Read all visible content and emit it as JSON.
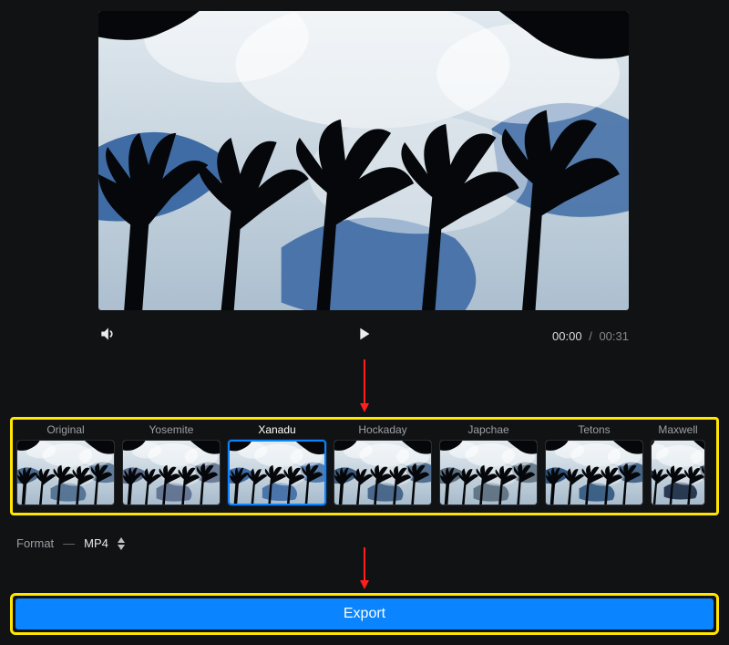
{
  "player": {
    "current_time": "00:00",
    "duration": "00:31",
    "separator": "/"
  },
  "filters": {
    "items": [
      {
        "label": "Original",
        "selected": false
      },
      {
        "label": "Yosemite",
        "selected": false
      },
      {
        "label": "Xanadu",
        "selected": true
      },
      {
        "label": "Hockaday",
        "selected": false
      },
      {
        "label": "Japchae",
        "selected": false
      },
      {
        "label": "Tetons",
        "selected": false
      },
      {
        "label": "Maxwell",
        "selected": false
      }
    ]
  },
  "format": {
    "label": "Format",
    "value": "MP4"
  },
  "export_label": "Export",
  "colors": {
    "accent": "#0a84ff",
    "annotation_arrow": "#ff1f1f",
    "annotation_frame": "#ffe500"
  },
  "filter_tones": [
    {
      "sky_top": "#d7dde2",
      "sky_bot": "#9fb0bd",
      "blue": "#4e6d8e"
    },
    {
      "sky_top": "#e9d8d4",
      "sky_bot": "#b4b4c6",
      "blue": "#5c6e8d"
    },
    {
      "sky_top": "#e6edf2",
      "sky_bot": "#a6bacb",
      "blue": "#3f6ca5"
    },
    {
      "sky_top": "#cfd6db",
      "sky_bot": "#98a3ad",
      "blue": "#3e5e83"
    },
    {
      "sky_top": "#ece4d1",
      "sky_bot": "#b9b197",
      "blue": "#5b6e7e"
    },
    {
      "sky_top": "#d0d7df",
      "sky_bot": "#8d9aaa",
      "blue": "#31557d"
    },
    {
      "sky_top": "#3a4452",
      "sky_bot": "#1b232e",
      "blue": "#1a2a44"
    }
  ]
}
